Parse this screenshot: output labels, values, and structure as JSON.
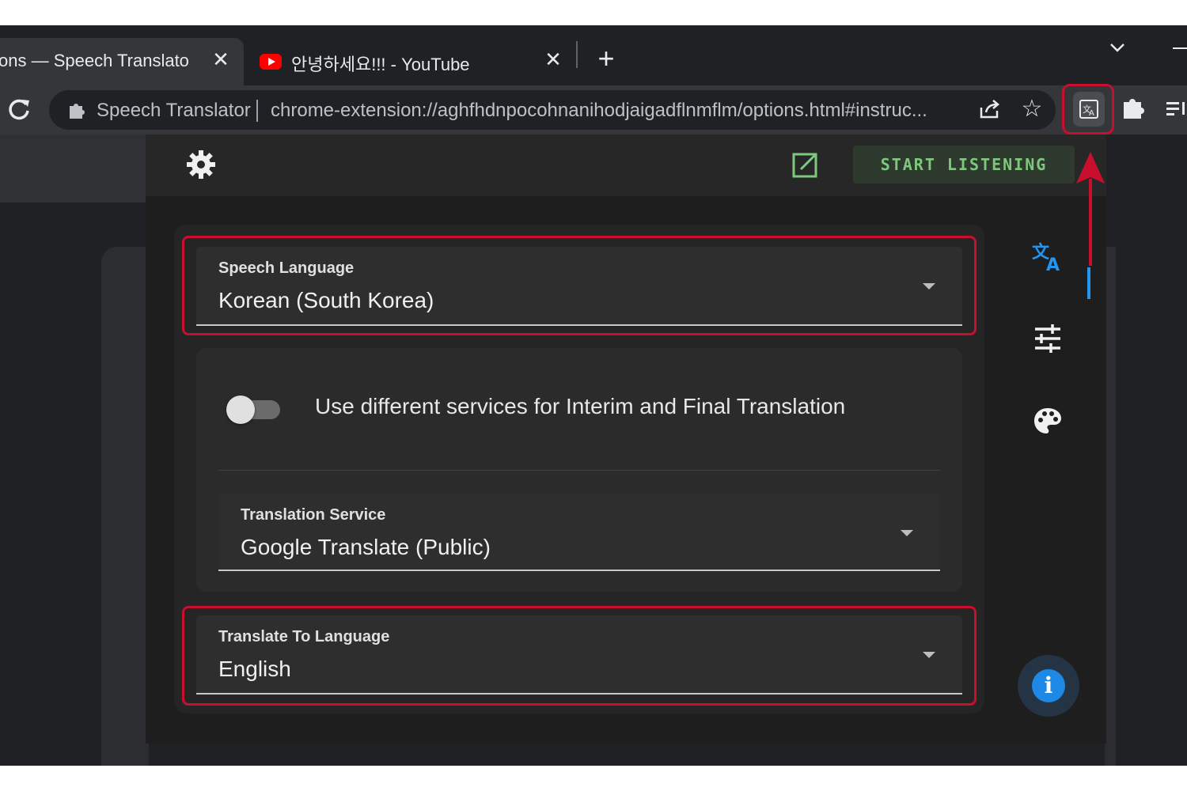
{
  "browser": {
    "tabs": [
      {
        "title": "ons — Speech Translator",
        "close": "✕",
        "active": true
      },
      {
        "title": "안녕하세요!!! - YouTube",
        "close": "✕",
        "active": false
      }
    ],
    "new_tab": "+",
    "address_bar": {
      "site_label": "Speech Translator",
      "url": "chrome-extension://aghfhdnpocohnanihodjaigadflnmflm/options.html#instruc..."
    }
  },
  "popup": {
    "start_button": "START LISTENING",
    "speech_language": {
      "label": "Speech Language",
      "value": "Korean (South Korea)"
    },
    "toggle": {
      "text": "Use different services for Interim and Final Translation",
      "on": false
    },
    "translation_service": {
      "label": "Translation Service",
      "value": "Google Translate (Public)"
    },
    "translate_to": {
      "label": "Translate To Language",
      "value": "English"
    }
  },
  "colors": {
    "annotation": "#c8102e",
    "accent": "#2196f3",
    "start_text": "#7ec87e"
  },
  "icons": [
    "reload-icon",
    "puzzle-icon",
    "share-icon",
    "star-icon",
    "translator-extension-icon",
    "extensions-icon",
    "media-control-icon",
    "gear-icon",
    "open-external-icon",
    "translate-icon",
    "tune-icon",
    "palette-icon",
    "info-icon",
    "youtube-icon"
  ]
}
